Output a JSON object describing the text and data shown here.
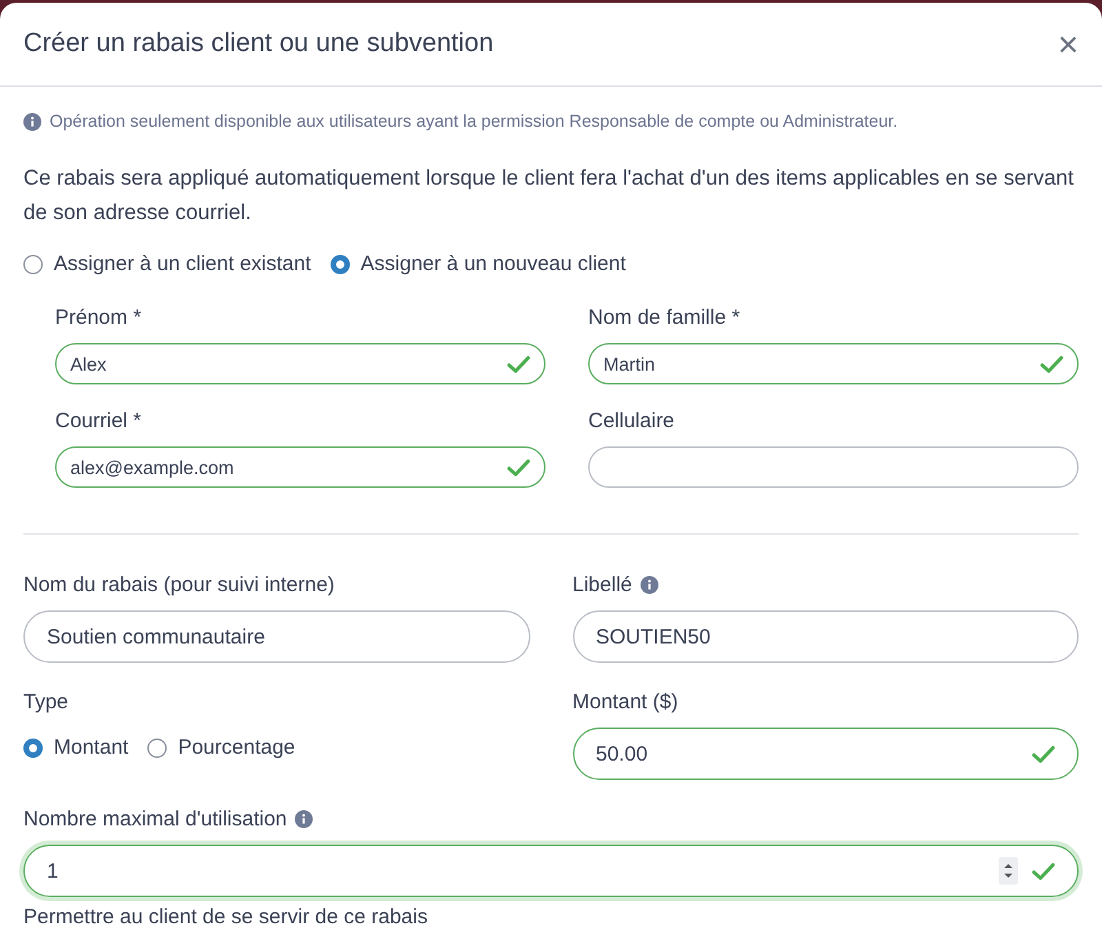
{
  "dialog": {
    "title": "Créer un rabais client ou une subvention",
    "close": "×"
  },
  "notice": "Opération seulement disponible aux utilisateurs ayant la permission Responsable de compte ou Administrateur.",
  "description": "Ce rabais sera appliqué automatiquement lorsque le client fera l'achat d'un des items applicables en se servant de son adresse courriel.",
  "assign_options": [
    {
      "label": "Assigner à un client existant",
      "selected": false
    },
    {
      "label": "Assigner à un nouveau client",
      "selected": true
    }
  ],
  "client_fields": [
    {
      "label": "Prénom *",
      "value": "Alex",
      "valid": true
    },
    {
      "label": "Nom de famille *",
      "value": "Martin",
      "valid": true
    },
    {
      "label": "Courriel *",
      "value": "alex@example.com",
      "valid": true
    },
    {
      "label": "Cellulaire",
      "valid": false
    }
  ],
  "discount_name": {
    "label": "Nom du rabais (pour suivi interne)",
    "value": "Soutien communautaire",
    "valid": false
  },
  "code": {
    "label": "Libellé",
    "info": true,
    "value": "SOUTIEN50",
    "valid": false
  },
  "type": {
    "label": "Type",
    "options": [
      {
        "label": "Montant",
        "selected": true
      },
      {
        "label": "Pourcentage",
        "selected": false
      }
    ]
  },
  "amount": {
    "label": "Montant ($)",
    "value": "50.00",
    "valid": true
  },
  "max_uses": {
    "label": "Nombre maximal d'utilisation",
    "info": true,
    "value": "1",
    "valid": true,
    "focused": true
  },
  "next_label": "Permettre au client de se servir de ce rabais"
}
